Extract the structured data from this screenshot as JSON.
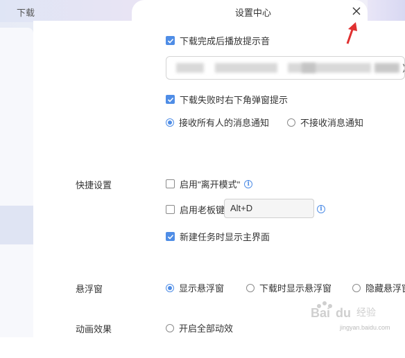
{
  "background": {
    "tab_label": "下载"
  },
  "window": {
    "title": "设置中心"
  },
  "download": {
    "play_sound_label": "下载完成后播放提示音",
    "play_sound_checked": true,
    "sound_path_suffix": ")",
    "fail_popup_label": "下载失败时右下角弹窗提示",
    "fail_popup_checked": true,
    "notify_all_label": "接收所有人的消息通知",
    "notify_none_label": "不接收消息通知",
    "notify_selected": "all"
  },
  "shortcut": {
    "section_label": "快捷设置",
    "away_mode_label": "启用\"离开模式\"",
    "away_mode_checked": false,
    "boss_key_label": "启用老板键",
    "boss_key_checked": false,
    "boss_key_value": "Alt+D",
    "new_task_label": "新建任务时显示主界面",
    "new_task_checked": true
  },
  "float_window": {
    "section_label": "悬浮窗",
    "options": [
      "显示悬浮窗",
      "下载时显示悬浮窗",
      "隐藏悬浮窗"
    ],
    "selected_index": 0
  },
  "animation": {
    "section_label": "动画效果",
    "enable_all_label": "开启全部动效"
  },
  "watermark": {
    "logo_text": "Baidu 经验",
    "url": "jingyan.baidu.com"
  },
  "colors": {
    "accent": "#4f8de6",
    "annotation_arrow": "#e03030"
  }
}
